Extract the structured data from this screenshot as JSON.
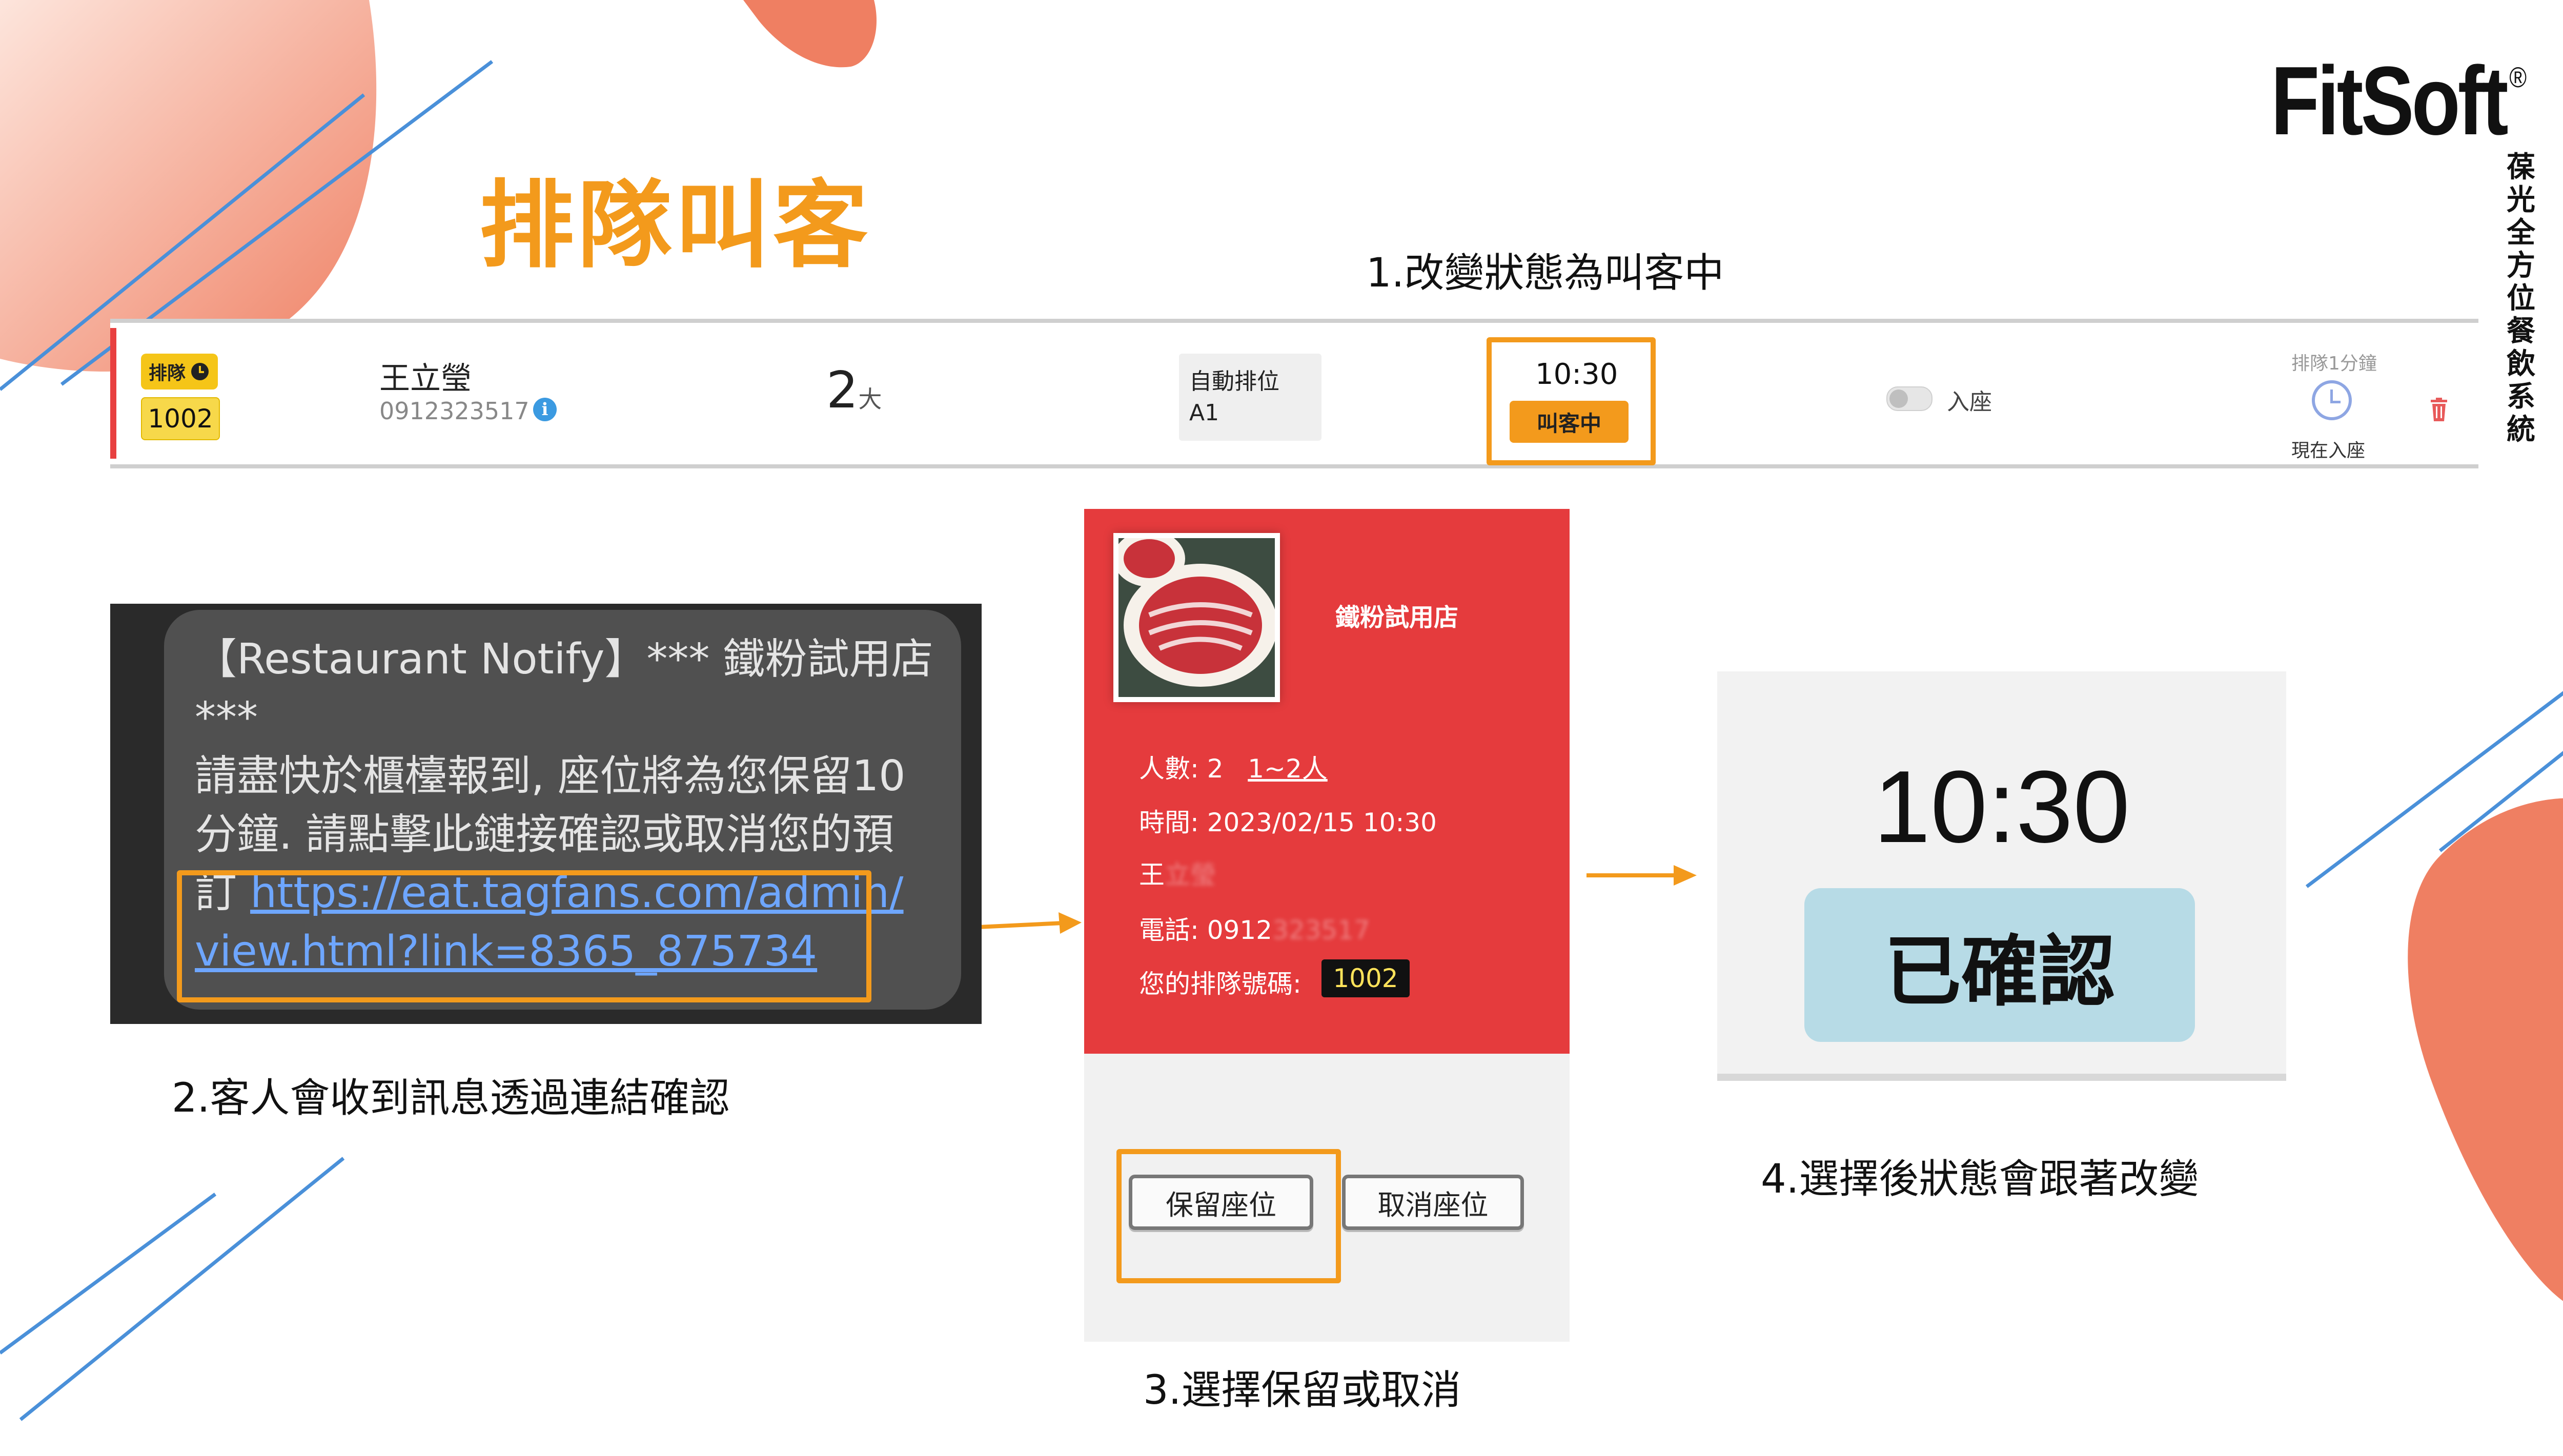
{
  "title": "排隊叫客",
  "logo": {
    "name": "FitSoft",
    "reg": "®",
    "vertical": "葆光全方位餐飲系統"
  },
  "steps": {
    "s1": "1.改變狀態為叫客中",
    "s2": "2.客人會收到訊息透過連結確認",
    "s3": "3.選擇保留或取消",
    "s4": "4.選擇後狀態會跟著改變"
  },
  "queue_row": {
    "tag_label": "排隊",
    "number": "1002",
    "name": "王立瑩",
    "phone": "0912323517",
    "info_icon": "i",
    "people": "2",
    "people_unit": "大",
    "seat_mode": "自動排位",
    "seat": "A1",
    "time": "10:30",
    "status": "叫客中",
    "seat_toggle_label": "入座",
    "wait": "排隊1分鐘",
    "now_seat": "現在入座"
  },
  "sms": {
    "line1": "【Restaurant Notify】*** 鐵粉試用店",
    "line2": "***",
    "line3": "請盡快於櫃檯報到, 座位將為您保留10",
    "line4": "分鐘. 請點擊此鏈接確認或取消您的預",
    "line5_prefix": "訂 ",
    "link1": "https://eat.tagfans.com/admin/",
    "link2": "view.html?link=8365_875734"
  },
  "mobile": {
    "store": "鐵粉試用店",
    "people_label": "人數: 2",
    "people_range": "1~2人",
    "time": "時間: 2023/02/15 10:30",
    "name_prefix": "王",
    "name_hidden": "立瑩",
    "phone_prefix": "電話: 0912",
    "phone_hidden": "323517",
    "qnum_label": "您的排隊號碼:",
    "qnum": "1002",
    "keep": "保留座位",
    "cancel": "取消座位"
  },
  "confirm": {
    "time": "10:30",
    "status": "已確認"
  },
  "colors": {
    "accent": "#f39a1c",
    "red": "#e53b3d",
    "blob": "#ef7f62",
    "line": "#4a90d9",
    "badge": "#b7dbe6"
  }
}
